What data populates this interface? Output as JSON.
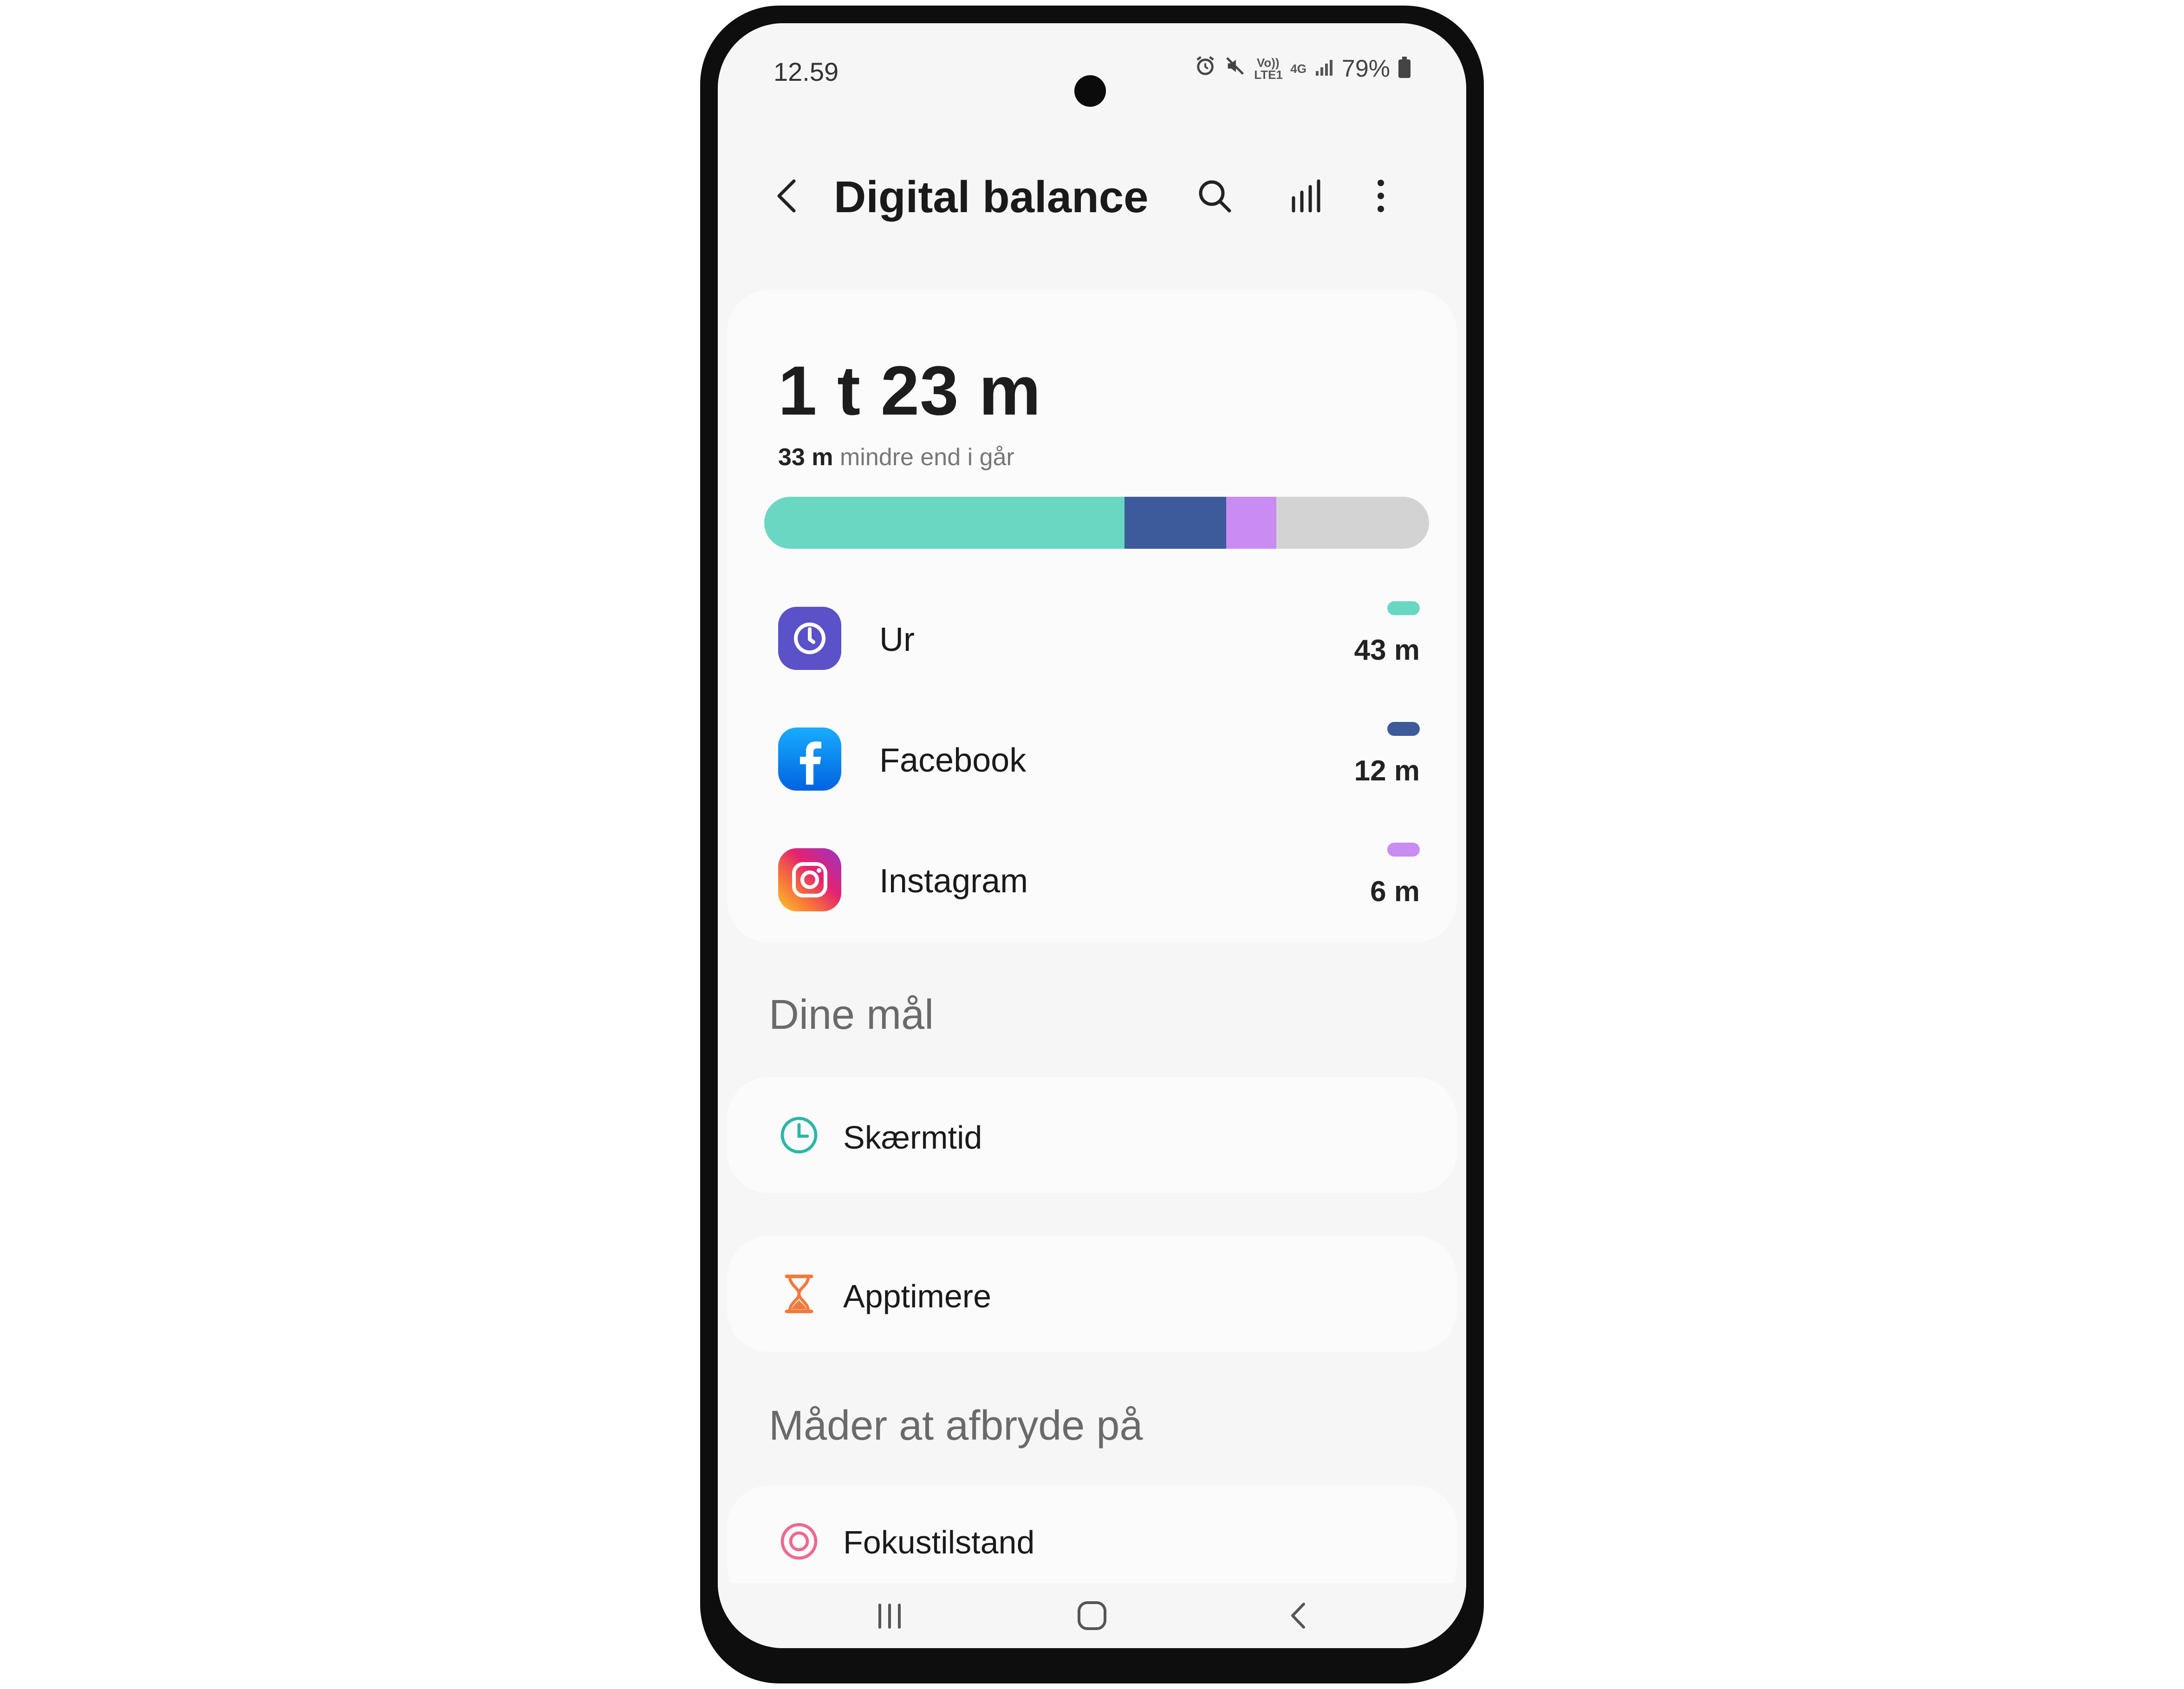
{
  "status_bar": {
    "time": "12.59",
    "volte_label": "Vo)) LTE1",
    "network": "4G",
    "battery": "79%"
  },
  "app_bar": {
    "title": "Digital balance"
  },
  "summary": {
    "total_time": "1 t 23 m",
    "delta_value": "33 m",
    "delta_text": "mindre end i går",
    "usage_fractions": [
      {
        "app": "Ur",
        "fraction": 0.542,
        "color": "#6ad7c3"
      },
      {
        "app": "Facebook",
        "fraction": 0.153,
        "color": "#3d5a9b"
      },
      {
        "app": "Instagram",
        "fraction": 0.075,
        "color": "#c98cf3"
      }
    ]
  },
  "apps": [
    {
      "name": "Ur",
      "time": "43 m",
      "color": "#6ad7c3",
      "icon": "clock-app-icon"
    },
    {
      "name": "Facebook",
      "time": "12 m",
      "color": "#3d5a9b",
      "icon": "facebook-icon"
    },
    {
      "name": "Instagram",
      "time": "6 m",
      "color": "#c98cf3",
      "icon": "instagram-icon"
    }
  ],
  "goals": {
    "section_title": "Dine mål",
    "screen_time_label": "Skærmtid",
    "app_timers_label": "Apptimere"
  },
  "disconnect": {
    "section_title": "Måder at afbryde på",
    "focus_mode_label": "Fokustilstand"
  }
}
